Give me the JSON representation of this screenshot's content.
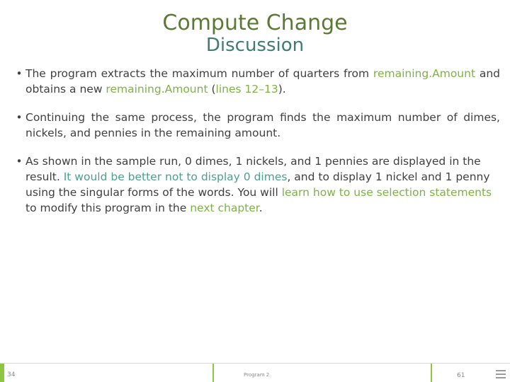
{
  "slide": {
    "title_line1": "Compute Change",
    "title_line2": "Discussion",
    "bullets": [
      {
        "marker": "•",
        "segments": [
          {
            "text": "The program extracts the maximum number of quarters from ",
            "style": "plain"
          },
          {
            "text": "remaining.Amount",
            "style": "green"
          },
          {
            "text": " and obtains a new ",
            "style": "plain"
          },
          {
            "text": "remaining.Amount",
            "style": "green"
          },
          {
            "text": " (",
            "style": "plain"
          },
          {
            "text": "lines 12–13",
            "style": "green"
          },
          {
            "text": ").",
            "style": "plain"
          }
        ]
      },
      {
        "marker": "•",
        "segments": [
          {
            "text": "Continuing the same process, the program finds the maximum number of dimes, nickels, and pennies in the remaining amount.",
            "style": "plain"
          }
        ]
      },
      {
        "marker": "•",
        "segments": [
          {
            "text": "As shown in the sample run, 0 dimes, 1 nickels, and 1 pennies are displayed in the result. ",
            "style": "plain"
          },
          {
            "text": "It would be better not to display 0 dimes",
            "style": "teal"
          },
          {
            "text": ", and to display 1 nickel and 1 penny using the singular forms of the words. You will ",
            "style": "plain"
          },
          {
            "text": "learn how to use selection statements",
            "style": "green"
          },
          {
            "text": " to modify this program in the ",
            "style": "plain"
          },
          {
            "text": "next chapter",
            "style": "green"
          },
          {
            "text": ".",
            "style": "plain"
          }
        ]
      }
    ]
  },
  "footer": {
    "left": "34",
    "center": "Program 2",
    "right": "61",
    "menu_icon": "hamburger-icon"
  },
  "colors": {
    "title_green": "#5a7a33",
    "title_teal": "#3f7d6e",
    "keyword_green": "#7cb342",
    "keyword_teal": "#4b9f8c",
    "accent_bar": "#8ec63f"
  }
}
